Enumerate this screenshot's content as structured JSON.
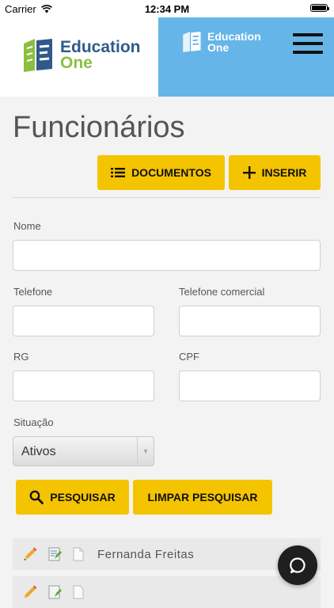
{
  "status_bar": {
    "carrier": "Carrier",
    "time": "12:34 PM"
  },
  "header": {
    "logo": {
      "line1": "Education",
      "line2": "One"
    },
    "logo_small": {
      "line1": "Education",
      "line2": "One"
    },
    "menu_icon": "hamburger-icon"
  },
  "page": {
    "title": "Funcionários"
  },
  "actions": {
    "documents_label": "DOCUMENTOS",
    "insert_label": "INSERIR"
  },
  "form": {
    "nome_label": "Nome",
    "nome_value": "",
    "telefone_label": "Telefone",
    "telefone_value": "",
    "telefone_comercial_label": "Telefone comercial",
    "telefone_comercial_value": "",
    "rg_label": "RG",
    "rg_value": "",
    "cpf_label": "CPF",
    "cpf_value": "",
    "situacao_label": "Situação",
    "situacao_value": "Ativos"
  },
  "search": {
    "search_label": "PESQUISAR",
    "clear_label": "LIMPAR PESQUISAR"
  },
  "results": [
    {
      "name": "Fernanda Freitas"
    },
    {
      "name": ""
    }
  ],
  "colors": {
    "accent": "#f5c400",
    "header_blue": "#66b5e8",
    "brand_blue": "#2f5a8a",
    "brand_green": "#8cbf3f"
  }
}
